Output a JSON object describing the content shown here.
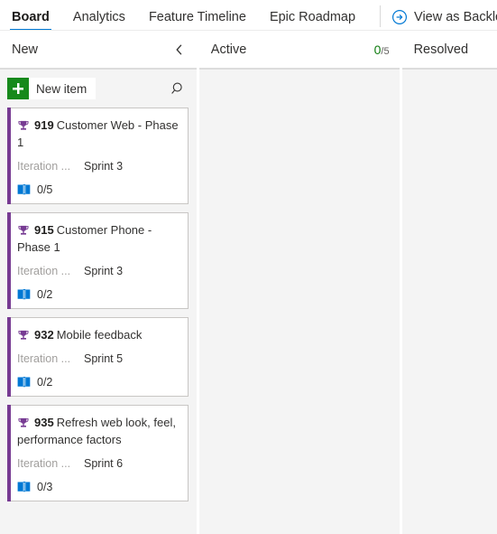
{
  "tabs": [
    {
      "label": "Board",
      "active": true
    },
    {
      "label": "Analytics",
      "active": false
    },
    {
      "label": "Feature Timeline",
      "active": false
    },
    {
      "label": "Epic Roadmap",
      "active": false
    }
  ],
  "view_backlog": {
    "label": "View as Backlog",
    "icon": "circle-arrow-right-icon",
    "color": "#0078d4"
  },
  "board": {
    "columns": [
      {
        "name": "New",
        "count": null,
        "limit": null,
        "collapsible": true,
        "collapse_icon": "chevron-left-icon",
        "toolbar": {
          "new_item_label": "New item",
          "new_item_icon": "plus-icon",
          "new_item_color": "#16891b",
          "search_icon": "search-icon"
        },
        "cards": [
          {
            "type_icon": "trophy-icon",
            "type_color": "#773b93",
            "id": "919",
            "title": "Customer Web - Phase 1",
            "field_label": "Iteration ...",
            "field_value": "Sprint 3",
            "progress_icon": "story-book-icon",
            "progress": "0/5"
          },
          {
            "type_icon": "trophy-icon",
            "type_color": "#773b93",
            "id": "915",
            "title": "Customer Phone - Phase 1",
            "field_label": "Iteration ...",
            "field_value": "Sprint 3",
            "progress_icon": "story-book-icon",
            "progress": "0/2"
          },
          {
            "type_icon": "trophy-icon",
            "type_color": "#773b93",
            "id": "932",
            "title": "Mobile feedback",
            "field_label": "Iteration ...",
            "field_value": "Sprint 5",
            "progress_icon": "story-book-icon",
            "progress": "0/2"
          },
          {
            "type_icon": "trophy-icon",
            "type_color": "#773b93",
            "id": "935",
            "title": "Refresh web look, feel, performance factors",
            "field_label": "Iteration ...",
            "field_value": "Sprint 6",
            "progress_icon": "story-book-icon",
            "progress": "0/3"
          }
        ]
      },
      {
        "name": "Active",
        "count": "0",
        "limit": "/5",
        "count_color": "#107c10",
        "collapsible": false,
        "cards": []
      },
      {
        "name": "Resolved",
        "count": null,
        "limit": null,
        "collapsible": false,
        "cards": []
      }
    ]
  }
}
